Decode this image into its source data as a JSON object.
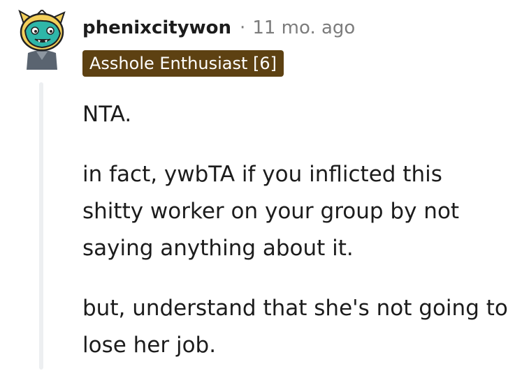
{
  "comment": {
    "username": "phenixcitywon",
    "separator": "·",
    "timestamp": "11 mo. ago",
    "flair": "Asshole Enthusiast [6]",
    "paragraphs": [
      "NTA.",
      "in fact, ywbTA if you inflicted this shitty worker on your group by not saying anything about it.",
      "but, understand that she's not going to lose her job."
    ]
  },
  "colors": {
    "flair_background": "#5d4112",
    "flair_text": "#ffffff",
    "meta_text": "#7c7c7c",
    "body_text": "#1c1c1c",
    "thread_line": "#edeff1",
    "avatar_teal": "#2fb6a8",
    "avatar_yellow": "#f3cf5a"
  },
  "icons": {
    "avatar": "snoo-avatar-icon"
  }
}
